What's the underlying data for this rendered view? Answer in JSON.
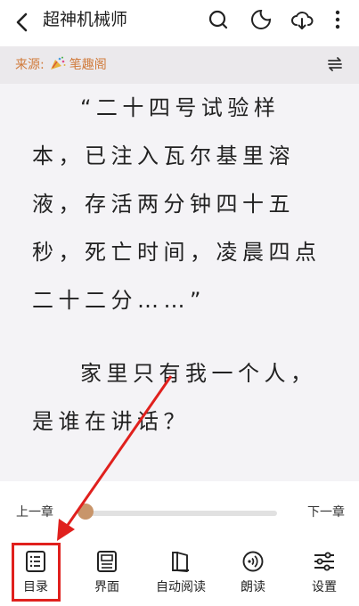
{
  "header": {
    "title": "超神机械师",
    "icons": [
      "back-icon",
      "search-icon",
      "night-mode-icon",
      "cloud-download-icon",
      "more-vert-icon"
    ]
  },
  "source": {
    "label": "来源:",
    "name": "笔趣阁",
    "icons": [
      "party-popper-icon",
      "switch-source-icon"
    ]
  },
  "content": {
    "paragraphs": [
      "“二十四号试验样本，已注入瓦尔基里溶液，存活两分钟四十五秒，死亡时间，凌晨四点二十二分……”",
      "家里只有我一个人，是谁在讲话？"
    ]
  },
  "chapter_nav": {
    "prev_label": "上一章",
    "next_label": "下一章",
    "progress": 0.0
  },
  "bottom_bar": {
    "items": [
      {
        "label": "目录",
        "icon": "toc-list-icon"
      },
      {
        "label": "界面",
        "icon": "layout-icon"
      },
      {
        "label": "自动阅读",
        "icon": "book-icon"
      },
      {
        "label": "朗读",
        "icon": "read-aloud-icon"
      },
      {
        "label": "设置",
        "icon": "settings-sliders-icon"
      }
    ]
  },
  "colors": {
    "accent": "#c8956a",
    "source_text": "#d07a3a",
    "annotation_red": "#e0201d",
    "content_bg": "#f4f3f6"
  }
}
